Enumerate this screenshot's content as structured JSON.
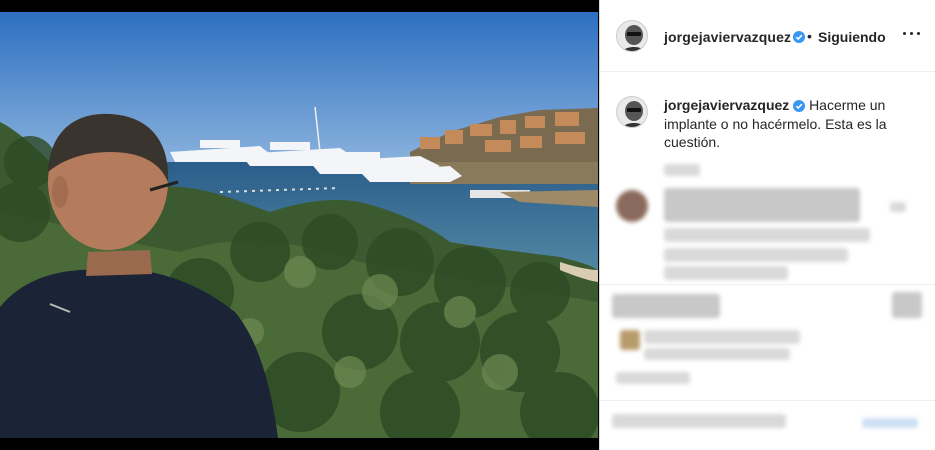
{
  "post": {
    "username": "jorgejaviervazquez",
    "separator": "•",
    "follow_label": "Siguiendo",
    "caption_text": "Hacerme un implante o no hacérmelo. Esta es la cuestión.",
    "comments_blurred": true
  },
  "icons": {
    "verified": "verified-badge-icon",
    "more": "more-options-icon"
  },
  "colors": {
    "verified_blue": "#3897f0",
    "text": "#262626",
    "divider": "#efefef"
  }
}
